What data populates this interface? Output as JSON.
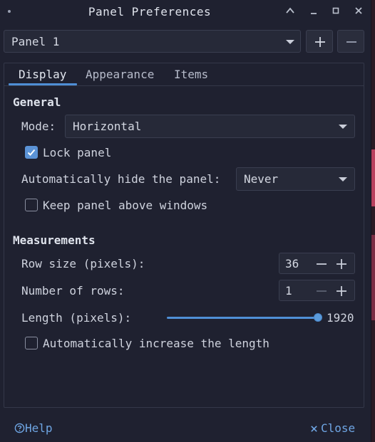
{
  "window": {
    "title": "Panel Preferences"
  },
  "panel_selector": {
    "value": "Panel 1",
    "add_label": "+",
    "remove_label": "−"
  },
  "tabs": [
    {
      "label": "Display",
      "active": true
    },
    {
      "label": "Appearance",
      "active": false
    },
    {
      "label": "Items",
      "active": false
    }
  ],
  "general": {
    "heading": "General",
    "mode_label": "Mode:",
    "mode_value": "Horizontal",
    "lock_panel_label": "Lock panel",
    "lock_panel_checked": true,
    "autohide_label": "Automatically hide the panel:",
    "autohide_value": "Never",
    "keep_above_label": "Keep panel above windows",
    "keep_above_checked": false
  },
  "measurements": {
    "heading": "Measurements",
    "row_size_label": "Row size (pixels):",
    "row_size_value": "36",
    "rows_label": "Number of rows:",
    "rows_value": "1",
    "length_label": "Length (pixels):",
    "length_value": "1920",
    "length_fill_fraction": 1.0,
    "auto_increase_label": "Automatically increase the length",
    "auto_increase_checked": false
  },
  "footer": {
    "help_label": "Help",
    "close_label": "Close"
  },
  "colors": {
    "accent": "#4f8fd6",
    "link": "#6fa6e4",
    "background": "#1f2130"
  }
}
